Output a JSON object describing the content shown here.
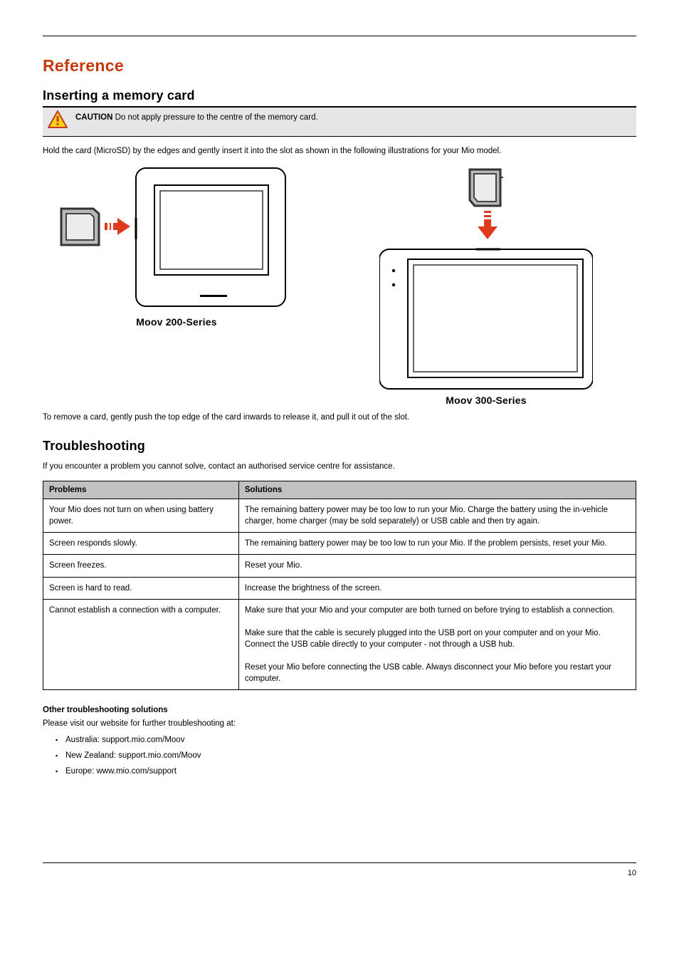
{
  "section_title": "Reference",
  "memcard": {
    "title": "Inserting a memory card",
    "caution_label": "CAUTION",
    "caution_text": " Do not apply pressure to the centre of the memory card.",
    "intro": "Hold the card (MicroSD) by the edges and gently insert it into the slot as shown in the following illustrations for your Mio model.",
    "caption_left": "Moov 200-Series",
    "caption_right": "Moov 300-Series",
    "remove": "To remove a card, gently push the top edge of the card inwards to release it, and pull it out of the slot."
  },
  "troubleshooting": {
    "title": "Troubleshooting",
    "intro": "If you encounter a problem you cannot solve, contact an authorised service centre for assistance.",
    "table": {
      "head_problem": "Problems",
      "head_solution": "Solutions",
      "rows": [
        {
          "problem": "Your Mio does not turn on when using battery power.",
          "solution": "The remaining battery power may be too low to run your Mio. Charge the battery using the in-vehicle charger, home charger (may be sold separately) or USB cable and then try again."
        },
        {
          "problem": "Screen responds slowly.",
          "solution": "The remaining battery power may be too low to run your Mio. If the problem persists, reset your Mio."
        },
        {
          "problem": "Screen freezes.",
          "solution": "Reset your Mio."
        },
        {
          "problem": "Screen is hard to read.",
          "solution": "Increase the brightness of the screen."
        },
        {
          "problem": "Cannot establish a connection with a computer.",
          "solution_lines": [
            "Make sure that your Mio and your computer are both turned on before trying to establish a connection.",
            "Make sure that the cable is securely plugged into the USB port on your computer and on your Mio. Connect the USB cable directly to your computer - not through a USB hub.",
            "Reset your Mio before connecting the USB cable. Always disconnect your Mio before you restart your computer."
          ]
        }
      ]
    }
  },
  "solutions": {
    "heading": "Other troubleshooting solutions",
    "intro": "Please visit our website for further troubleshooting at:",
    "bullets": [
      "Australia: support.mio.com/Moov",
      "New Zealand: support.mio.com/Moov",
      "Europe: www.mio.com/support"
    ]
  },
  "page_number": "10"
}
